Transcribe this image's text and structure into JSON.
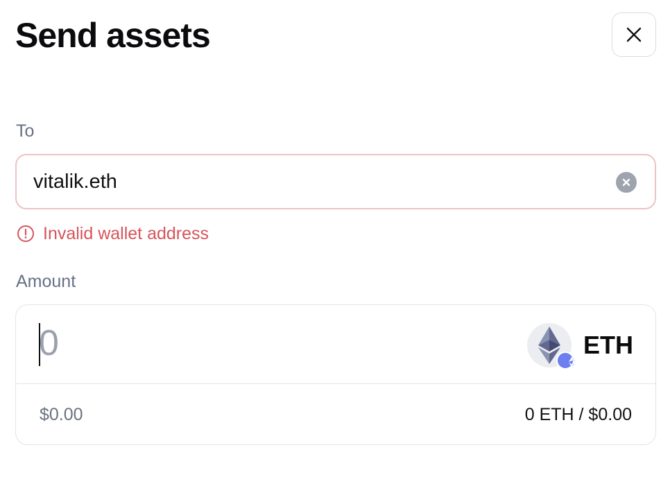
{
  "dialog": {
    "title": "Send assets",
    "close_icon": "close-icon"
  },
  "to_field": {
    "label": "To",
    "value": "vitalik.eth",
    "clear_icon": "clear-circle-icon",
    "error_icon": "alert-circle-icon",
    "error_message": "Invalid wallet address"
  },
  "amount_field": {
    "label": "Amount",
    "value": "0",
    "token_icon": "ethereum-icon",
    "token_symbol": "ETH",
    "usd_value": "$0.00",
    "conversion": "0 ETH / $0.00"
  },
  "colors": {
    "error": "#d6545b",
    "error_border": "#efc2c4",
    "chain_badge": "#6d7ff0",
    "muted_text": "#667085"
  }
}
